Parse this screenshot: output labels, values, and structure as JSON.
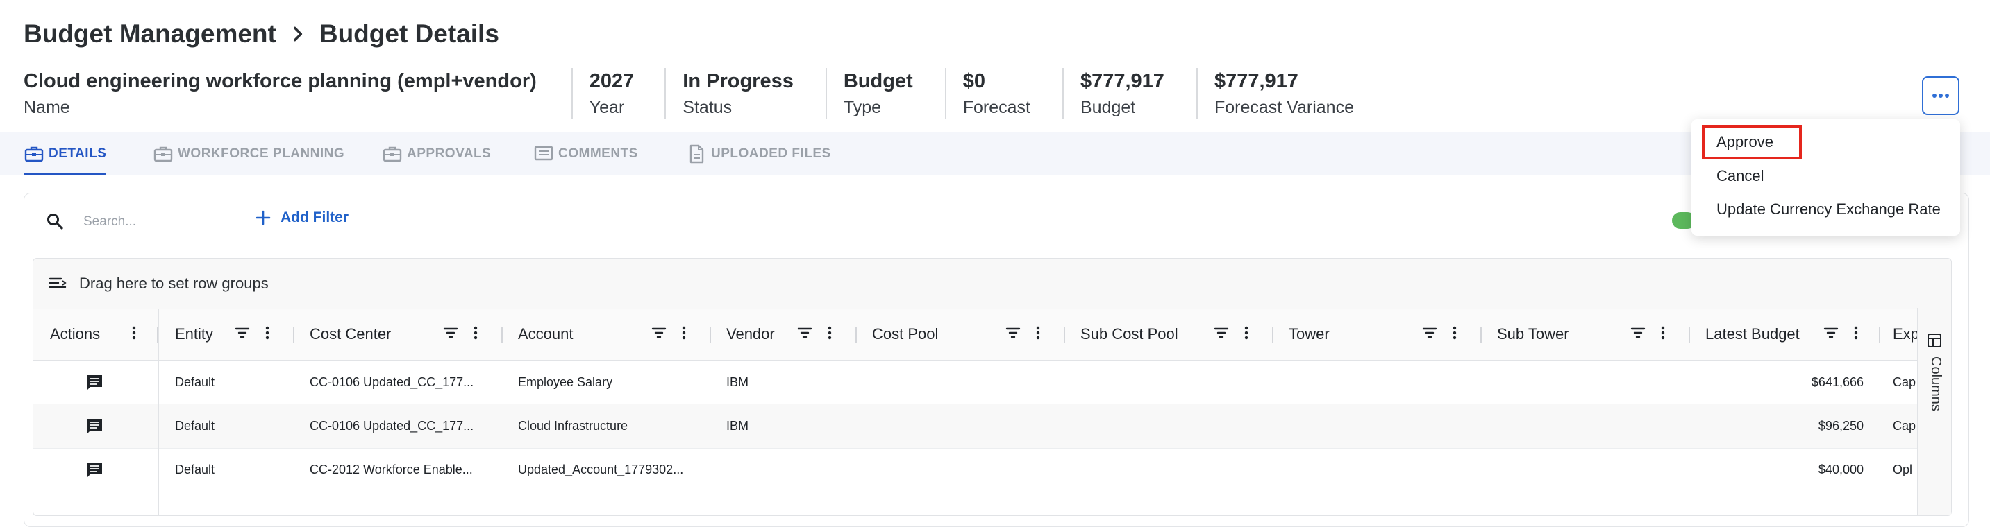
{
  "breadcrumb": {
    "parent": "Budget Management",
    "current": "Budget Details"
  },
  "summary": {
    "name": {
      "value": "Cloud engineering workforce planning (empl+vendor)",
      "label": "Name"
    },
    "year": {
      "value": "2027",
      "label": "Year"
    },
    "status": {
      "value": "In Progress",
      "label": "Status"
    },
    "type": {
      "value": "Budget",
      "label": "Type"
    },
    "forecast": {
      "value": "$0",
      "label": "Forecast"
    },
    "budget": {
      "value": "$777,917",
      "label": "Budget"
    },
    "forecast_variance": {
      "value": "$777,917",
      "label": "Forecast Variance"
    }
  },
  "tabs": [
    {
      "label": "DETAILS",
      "icon": "briefcase-icon",
      "active": true
    },
    {
      "label": "WORKFORCE PLANNING",
      "icon": "briefcase-icon",
      "active": false
    },
    {
      "label": "APPROVALS",
      "icon": "briefcase-icon",
      "active": false
    },
    {
      "label": "COMMENTS",
      "icon": "comment-icon",
      "active": false
    },
    {
      "label": "UPLOADED FILES",
      "icon": "file-icon",
      "active": false
    }
  ],
  "toolbar": {
    "search_placeholder": "Search...",
    "add_filter": "Add Filter"
  },
  "grid": {
    "group_bar_text": "Drag here to set row groups",
    "columns": [
      "Actions",
      "Entity",
      "Cost Center",
      "Account",
      "Vendor",
      "Cost Pool",
      "Sub Cost Pool",
      "Tower",
      "Sub Tower",
      "Latest Budget",
      "Exp"
    ],
    "rows": [
      {
        "entity": "Default",
        "cost_center": "CC-0106 Updated_CC_177...",
        "account": "Employee Salary",
        "vendor": "IBM",
        "cost_pool": "",
        "sub_cost_pool": "",
        "tower": "",
        "sub_tower": "",
        "latest_budget": "$641,666",
        "exp": "Cap"
      },
      {
        "entity": "Default",
        "cost_center": "CC-0106 Updated_CC_177...",
        "account": "Cloud Infrastructure",
        "vendor": "IBM",
        "cost_pool": "",
        "sub_cost_pool": "",
        "tower": "",
        "sub_tower": "",
        "latest_budget": "$96,250",
        "exp": "Cap"
      },
      {
        "entity": "Default",
        "cost_center": "CC-2012 Workforce Enable...",
        "account": "Updated_Account_1779302...",
        "vendor": "",
        "cost_pool": "",
        "sub_cost_pool": "",
        "tower": "",
        "sub_tower": "",
        "latest_budget": "$40,000",
        "exp": "Opl"
      }
    ],
    "side_panel_label": "Columns"
  },
  "menu": {
    "items": [
      "Approve",
      "Cancel",
      "Update Currency Exchange Rate"
    ],
    "highlighted": "Approve"
  },
  "colors": {
    "accent": "#2456c4",
    "highlight": "#e5261d",
    "toggle": "#5cb85c"
  }
}
